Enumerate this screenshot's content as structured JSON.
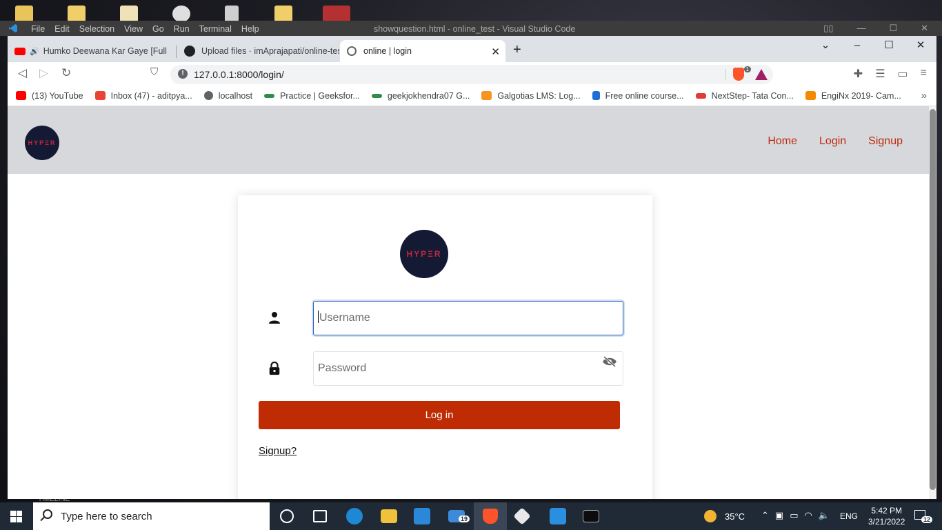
{
  "vscode": {
    "menus": [
      "File",
      "Edit",
      "Selection",
      "View",
      "Go",
      "Run",
      "Terminal",
      "Help"
    ],
    "title": "showquestion.html - online_test - Visual Studio Code",
    "timeline_label": "TIMELINE"
  },
  "browser": {
    "tabs": [
      {
        "label": "Humko Deewana Kar Gaye [Full So",
        "icon": "youtube-icon"
      },
      {
        "label": "Upload files · imAprajapati/online-test",
        "icon": "github-icon"
      },
      {
        "label": "online | login",
        "icon": "globe-icon",
        "active": true
      }
    ],
    "new_tab": "+",
    "close_tab": "✕",
    "window_controls": {
      "collapse": "⌄",
      "minimize": "–",
      "maximize": "☐",
      "close": "✕"
    },
    "url": "127.0.0.1:8000/login/",
    "shield_count": "1",
    "bookmarks": [
      {
        "label": "(13) YouTube",
        "color": "#ff0000"
      },
      {
        "label": "Inbox (47) - aditpya...",
        "color": "#ea4335"
      },
      {
        "label": "localhost",
        "color": "#5f6368"
      },
      {
        "label": "Practice | Geeksfor...",
        "color": "#2f8d46"
      },
      {
        "label": "geekjokhendra07 G...",
        "color": "#2f8d46"
      },
      {
        "label": "Galgotias LMS: Log...",
        "color": "#f7931e"
      },
      {
        "label": "Free online course...",
        "color": "#1d6fd6"
      },
      {
        "label": "NextStep- Tata Con...",
        "color": "#e23a3a"
      },
      {
        "label": "EngiNx 2019- Cam...",
        "color": "#f28b00"
      }
    ],
    "bookmarks_more": "»"
  },
  "site": {
    "logo_text": "HYPΞR",
    "nav": [
      "Home",
      "Login",
      "Signup"
    ],
    "form": {
      "username_placeholder": "Username",
      "password_placeholder": "Password",
      "login_label": "Log in",
      "signup_link": "Signup?"
    },
    "colors": {
      "accent": "#bf2b02",
      "logo_bg": "#141a33",
      "logo_text": "#c4273e",
      "navbar_bg": "#d6d8db"
    }
  },
  "taskbar": {
    "search_placeholder": "Type here to search",
    "temperature": "35°C",
    "language": "ENG",
    "time": "5:42 PM",
    "date": "3/21/2022",
    "mail_badge": "19",
    "notification_count": "12"
  }
}
